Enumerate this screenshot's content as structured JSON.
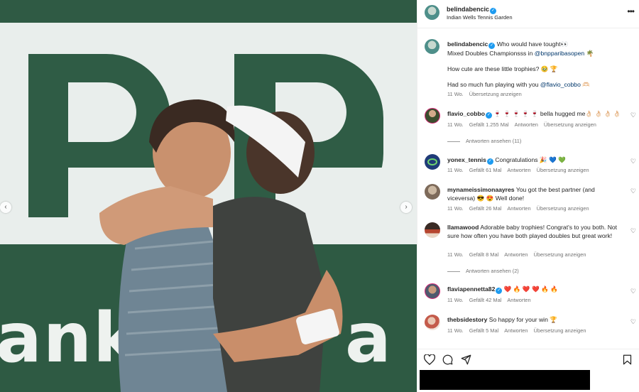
{
  "post": {
    "username": "belindabencic",
    "location": "Indian Wells Tennis Garden",
    "more_icon": "more-horizontal-icon"
  },
  "photo": {
    "banner_letters": "ank",
    "banner_letter_right": "a",
    "prev_icon": "chevron-left-icon",
    "next_icon": "chevron-right-icon",
    "prev_glyph": "‹",
    "next_glyph": "›"
  },
  "caption": {
    "username": "belindabencic",
    "line1": "Who would have tought👀",
    "line2_prefix": "Mixed Doubles Championsss in ",
    "line2_mention": "@bnpparibasopen",
    "line2_suffix": " 🌴",
    "line3": "How cute are these little trophies? 🥹 🏆",
    "line4_prefix": "Had so much fun playing with you ",
    "line4_mention": "@flavio_cobbo",
    "line4_suffix": " 🫶🏻",
    "age": "11 Wo.",
    "translate": "Übersetzung anzeigen"
  },
  "comments": [
    {
      "username": "flavio_cobbo",
      "verified": true,
      "text": "🍷 🍷 🍷 🍷 🍷 bella hugged me👌🏻 👌🏻 👌🏻 👌🏻",
      "age": "11 Wo.",
      "likes": "Gefällt 1.255 Mal",
      "reply": "Antworten",
      "translate": "Übersetzung anzeigen",
      "view_replies": "Antworten ansehen (11)"
    },
    {
      "username": "yonex_tennis",
      "verified": true,
      "text": "Congratulations 🎉 💙 💚",
      "age": "11 Wo.",
      "likes": "Gefällt 61 Mal",
      "reply": "Antworten",
      "translate": "Übersetzung anzeigen"
    },
    {
      "username": "mynameissimonaayres",
      "verified": false,
      "text": "You got the best partner (and viceversa) 😎 😍 Well done!",
      "age": "11 Wo.",
      "likes": "Gefällt 26 Mal",
      "reply": "Antworten",
      "translate": "Übersetzung anzeigen"
    },
    {
      "username": "llamawood",
      "verified": false,
      "text": "Adorable baby trophies! Congrat's to you both. Not sure how often you have both played doubles but great work!",
      "age": "11 Wo.",
      "likes": "Gefällt 8 Mal",
      "reply": "Antworten",
      "translate": "Übersetzung anzeigen",
      "view_replies": "Antworten ansehen (2)"
    },
    {
      "username": "flaviapennetta82",
      "verified": true,
      "text": "❤️ 🔥 ❤️ ❤️ 🔥 🔥",
      "age": "11 Wo.",
      "likes": "Gefällt 42 Mal",
      "reply": "Antworten",
      "translate": ""
    },
    {
      "username": "thebsidestory",
      "verified": false,
      "text": "So happy for your win 🏆",
      "age": "11 Wo.",
      "likes": "Gefällt 5 Mal",
      "reply": "Antworten",
      "translate": "Übersetzung anzeigen"
    }
  ],
  "actions": {
    "like_icon": "heart-icon",
    "comment_icon": "comment-icon",
    "share_icon": "share-icon",
    "save_icon": "bookmark-icon"
  },
  "colors": {
    "link": "#00376b",
    "muted": "#737373",
    "verified": "#1d9bf0",
    "banner_green": "#2e5a43"
  }
}
